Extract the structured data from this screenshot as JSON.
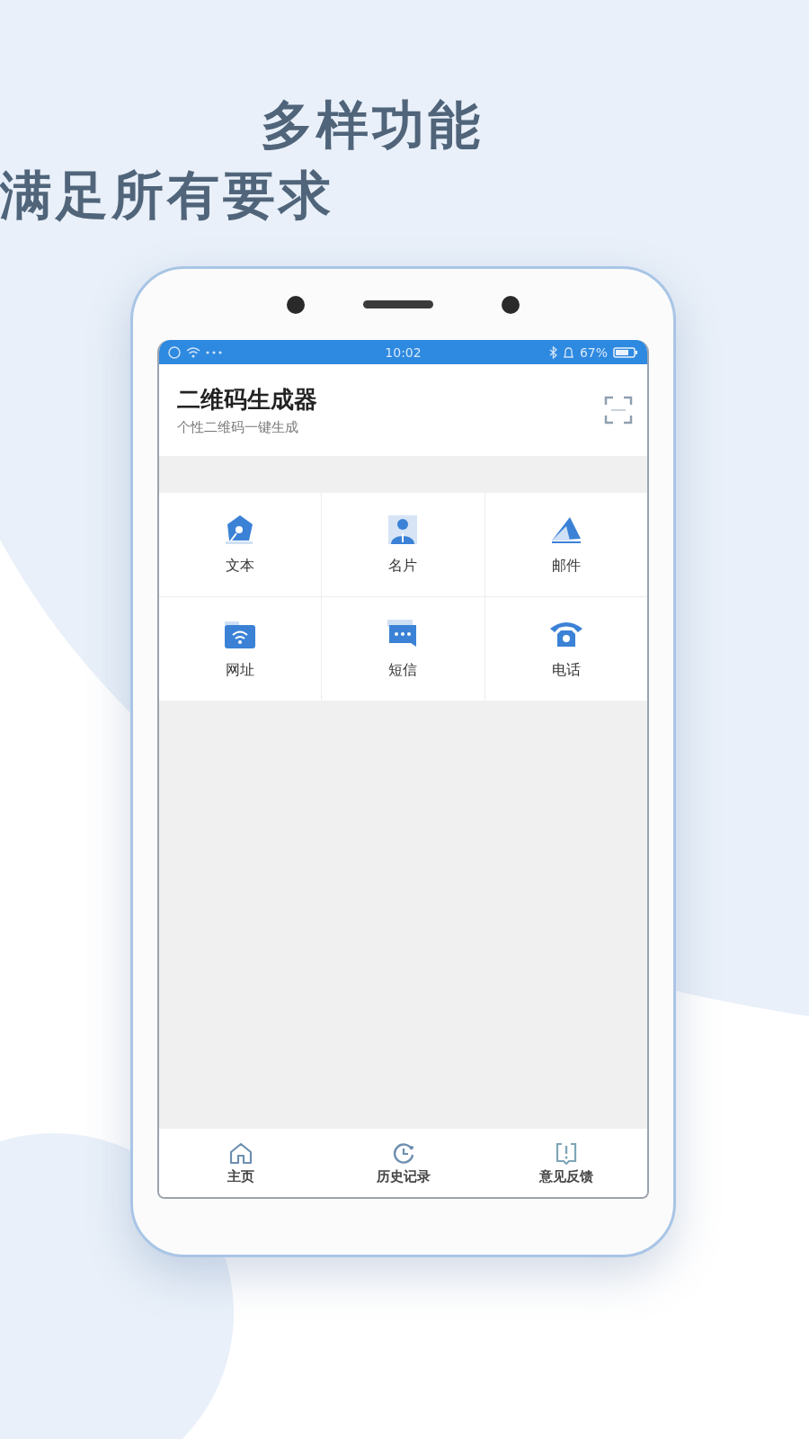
{
  "headline": [
    "多样功能",
    "满足所有要求"
  ],
  "status_bar": {
    "time": "10:02",
    "battery": "67%"
  },
  "app_header": {
    "title": "二维码生成器",
    "subtitle": "个性二维码一键生成"
  },
  "functions": [
    {
      "label": "文本",
      "kind": "pen"
    },
    {
      "label": "名片",
      "kind": "card"
    },
    {
      "label": "邮件",
      "kind": "mail"
    },
    {
      "label": "网址",
      "kind": "web"
    },
    {
      "label": "短信",
      "kind": "sms"
    },
    {
      "label": "电话",
      "kind": "phone"
    }
  ],
  "bottom_nav": [
    {
      "label": "主页",
      "kind": "home"
    },
    {
      "label": "历史记录",
      "kind": "history"
    },
    {
      "label": "意见反馈",
      "kind": "feedback"
    }
  ]
}
